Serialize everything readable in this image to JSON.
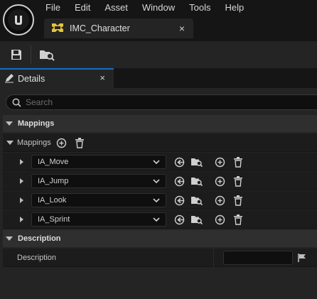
{
  "menu": [
    "File",
    "Edit",
    "Asset",
    "Window",
    "Tools",
    "Help"
  ],
  "asset_tab": {
    "label": "IMC_Character",
    "close": "×"
  },
  "details_tab": {
    "label": "Details",
    "close": "×"
  },
  "search": {
    "placeholder": "Search"
  },
  "sections": {
    "mappings": "Mappings",
    "description": "Description"
  },
  "mappings_row": {
    "label": "Mappings"
  },
  "mappings": [
    {
      "action": "IA_Move"
    },
    {
      "action": "IA_Jump"
    },
    {
      "action": "IA_Look"
    },
    {
      "action": "IA_Sprint"
    }
  ],
  "description_row": {
    "label": "Description",
    "value": ""
  },
  "icons": {
    "logo": "unreal-logo-icon",
    "asset": "input-mapping-asset-icon",
    "save": "save-icon",
    "browse": "browse-asset-icon",
    "details": "pencil-icon",
    "search": "search-icon"
  },
  "colors": {
    "accent": "#0f6fc6",
    "asset_icon": "#e2c43a"
  }
}
